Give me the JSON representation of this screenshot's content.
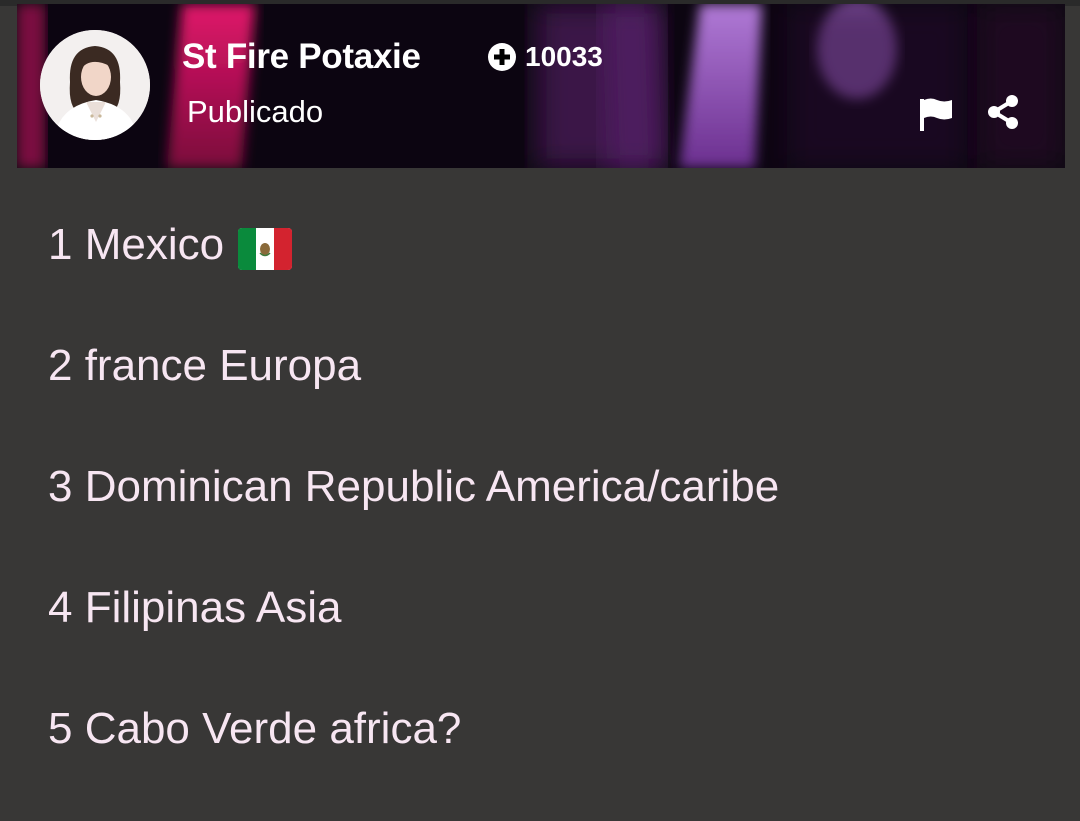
{
  "post": {
    "author": "St Fire Potaxie",
    "points": "10033",
    "status": "Publicado"
  },
  "icons": {
    "points": "plus-circle-icon",
    "report": "flag-icon",
    "share": "share-icon",
    "list_flag": "mexico-flag-icon"
  },
  "colors": {
    "page_background": "#383736",
    "list_text": "#f7e6f2",
    "header_text": "#ffffff",
    "accent_magenta": "#c2185b",
    "accent_purple": "#8e4ab5"
  },
  "list": [
    {
      "text": "1 Mexico"
    },
    {
      "text": "2 france Europa"
    },
    {
      "text": "3 Dominican Republic America/caribe"
    },
    {
      "text": "4 Filipinas Asia"
    },
    {
      "text": "5 Cabo Verde africa?"
    }
  ]
}
